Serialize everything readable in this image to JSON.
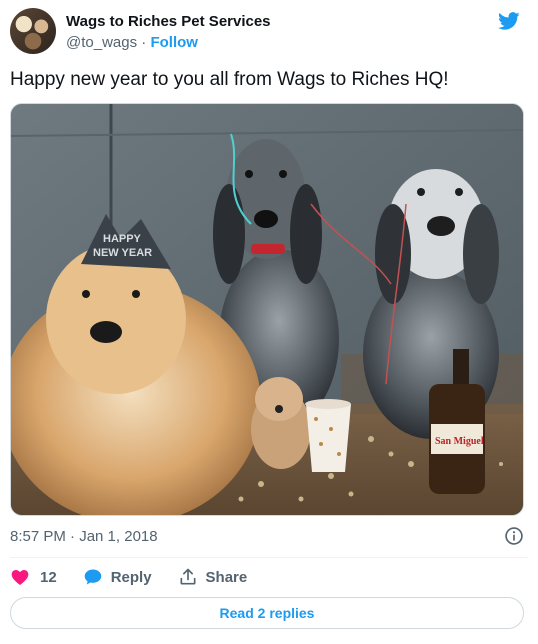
{
  "tweet": {
    "author_name": "Wags to Riches Pet Services",
    "handle": "@to_wags",
    "separator": " · ",
    "follow_label": "Follow",
    "text": "Happy new year to you all from Wags to Riches HQ!",
    "timestamp": "8:57 PM · Jan 1, 2018",
    "likes": "12",
    "reply_label": "Reply",
    "share_label": "Share",
    "read_replies_label": "Read 2 replies"
  },
  "photo": {
    "hat_text_line1": "HAPPY",
    "hat_text_line2": "NEW YEAR",
    "bottle_label": "San Miguel"
  },
  "icons": {
    "brand": "twitter-bird-icon",
    "info": "info-icon",
    "like": "heart-icon",
    "reply": "speech-bubble-icon",
    "share": "share-upload-icon"
  },
  "colors": {
    "accent": "#1d9bf0",
    "like": "#f91880",
    "muted_text": "#536471",
    "text": "#0f1419",
    "border": "#cfd9de"
  }
}
